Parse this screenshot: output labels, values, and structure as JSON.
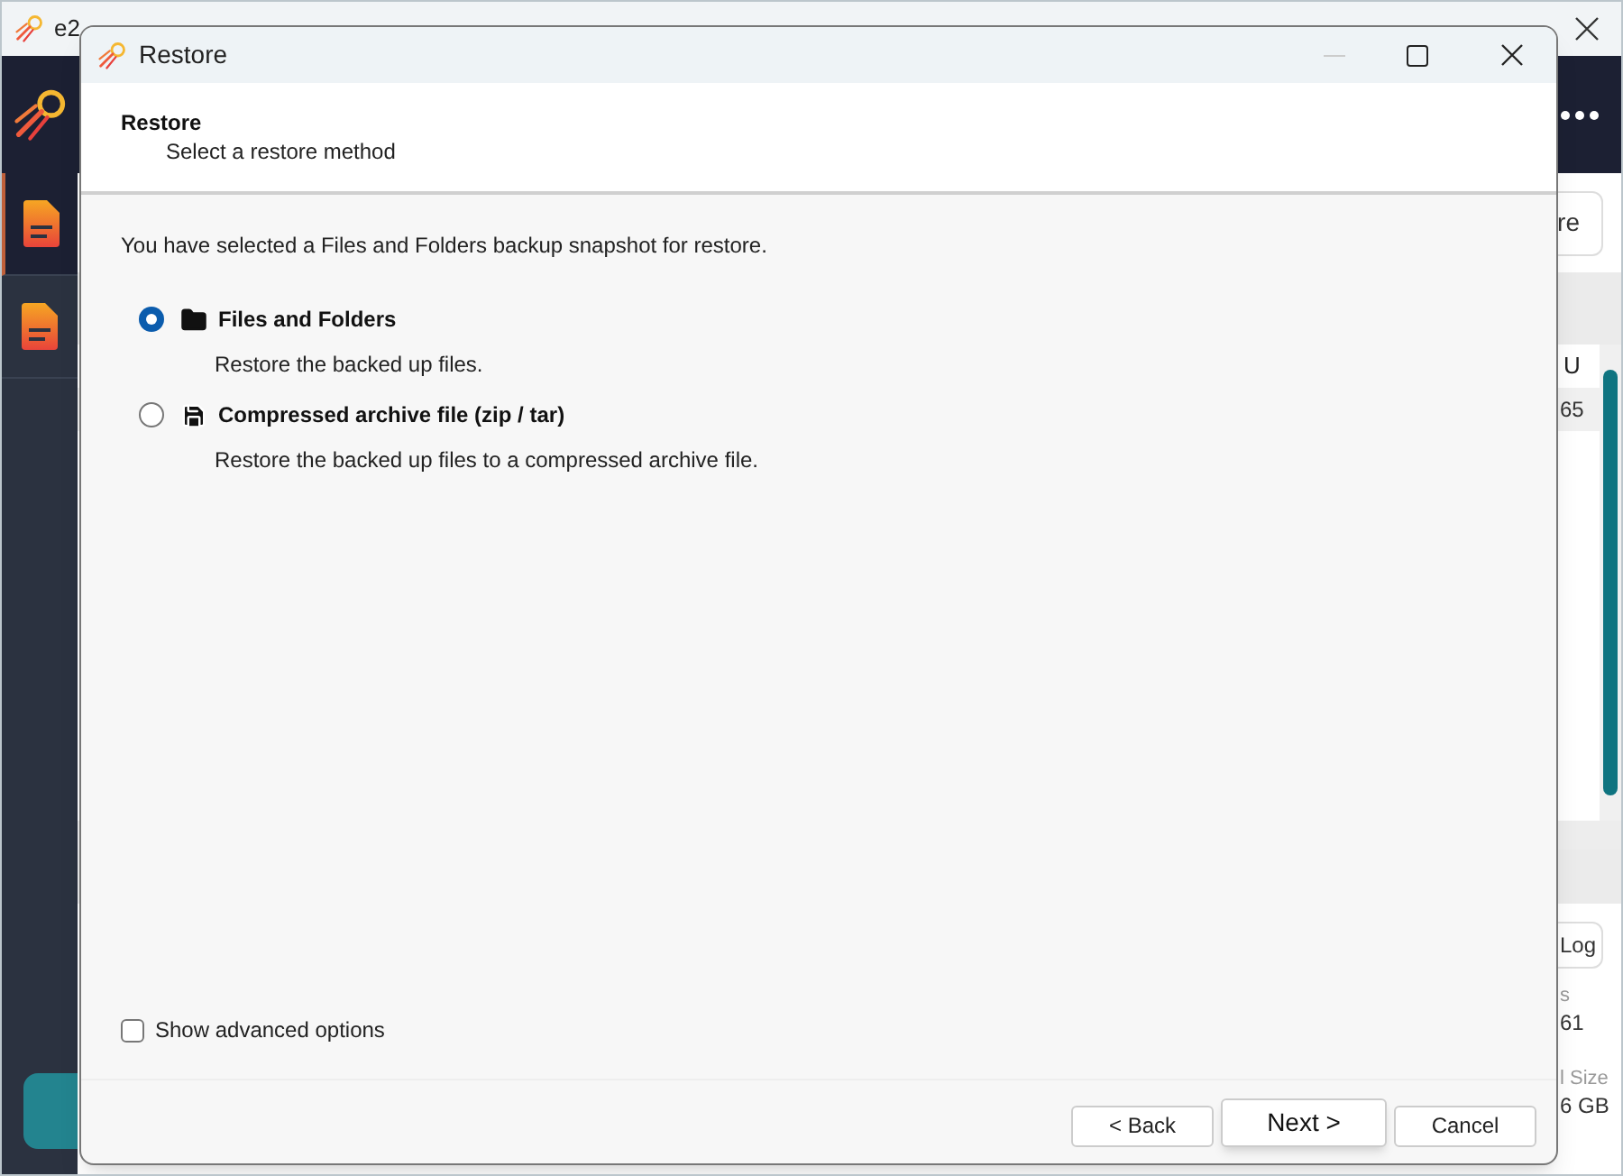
{
  "background_app": {
    "title": "e2",
    "sidebar_items": [
      {
        "selected": true
      },
      {
        "selected": false
      }
    ],
    "action_button": "re",
    "table": {
      "column_1": "U",
      "cell_1": "65"
    },
    "log_button": "Log",
    "stats": [
      {
        "label": "s",
        "value": "61"
      },
      {
        "label": "l Size",
        "value": "6 GB"
      }
    ]
  },
  "dialog": {
    "title": "Restore",
    "header": {
      "title": "Restore",
      "subtitle": "Select a restore method"
    },
    "intro": "You have selected a Files and Folders backup snapshot for restore.",
    "options": [
      {
        "kind": "folder",
        "label": "Files and Folders",
        "description": "Restore the backed up files.",
        "selected": true
      },
      {
        "kind": "disk",
        "label": "Compressed archive file (zip / tar)",
        "description": "Restore the backed up files to a compressed archive file.",
        "selected": false
      }
    ],
    "advanced": {
      "label": "Show advanced options",
      "checked": false
    },
    "buttons": [
      {
        "label": "< Back",
        "default": false
      },
      {
        "label": "Next >",
        "default": true
      },
      {
        "label": "Cancel",
        "default": false
      }
    ]
  }
}
